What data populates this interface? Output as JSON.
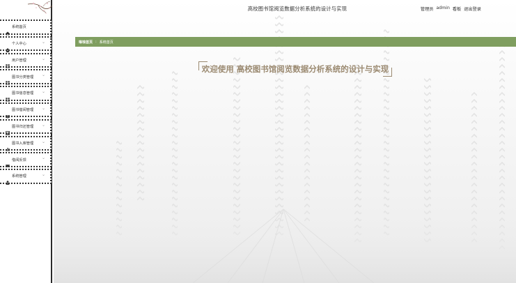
{
  "header": {
    "title": "高校图书馆阅览数据分析系统的设计与实现",
    "role": "管理员",
    "username": "admin",
    "dashboard_link": "看板",
    "logout_link": "退出登录"
  },
  "breadcrumb": {
    "home": "琳琅首页",
    "separator": ":",
    "current": "系统首页"
  },
  "welcome": {
    "text": "欢迎使用 高校图书馆阅览数据分析系统的设计与实现"
  },
  "sidebar": {
    "items": [
      {
        "label": "系统首页",
        "icon": "home-icon",
        "has_submenu": false
      },
      {
        "label": "个人中心",
        "icon": "user-icon",
        "has_submenu": true
      },
      {
        "label": "用户管理",
        "icon": "grid-icon",
        "has_submenu": true
      },
      {
        "label": "图书分类管理",
        "icon": "grid-icon",
        "has_submenu": true
      },
      {
        "label": "图书信息管理",
        "icon": "grid-icon",
        "has_submenu": true
      },
      {
        "label": "图书借阅管理",
        "icon": "book-icon",
        "has_submenu": true
      },
      {
        "label": "图书归还管理",
        "icon": "chart-icon",
        "has_submenu": true
      },
      {
        "label": "图书入库管理",
        "icon": "bar-chart-icon",
        "has_submenu": true
      },
      {
        "label": "借阅反馈",
        "icon": "ticket-icon",
        "has_submenu": true
      },
      {
        "label": "系统管理",
        "icon": "user-icon",
        "has_submenu": true
      }
    ]
  },
  "colors": {
    "accent_green": "#7f9e5f",
    "welcome_text": "#9b8a71",
    "sidebar_border": "#2a2a2a"
  }
}
